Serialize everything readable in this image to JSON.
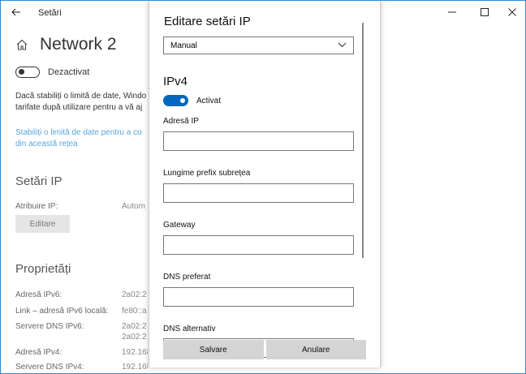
{
  "titlebar": {
    "title": "Setări",
    "icons": {
      "back": "back-arrow-icon",
      "minimize": "minimize-icon",
      "maximize": "maximize-icon",
      "close": "close-icon"
    }
  },
  "background": {
    "page_title": "Network 2",
    "home_icon": "home-icon",
    "toggle_label": "Dezactivat",
    "description_lines": [
      "Dacă stabiliți o limită de date, Windo",
      "tarifate după utilizare pentru a vă aj"
    ],
    "link_lines": [
      "Stabiliți o limită de date pentru a co",
      "din această rețea"
    ],
    "ip_section": {
      "heading": "Setări IP",
      "assign_label": "Atribuire IP:",
      "assign_value": "Autom",
      "edit_button": "Editare"
    },
    "properties": {
      "heading": "Proprietăți",
      "rows": [
        {
          "label": "Adresă IPv6:",
          "values": [
            "2a02:2"
          ]
        },
        {
          "label": "Link – adresă IPv6 locală:",
          "values": [
            "fe80::a"
          ]
        },
        {
          "label": "Servere DNS IPv6:",
          "values": [
            "2a02:2",
            "2a02:2"
          ]
        },
        {
          "label": "Adresă IPv4:",
          "values": [
            "192.168"
          ]
        },
        {
          "label": "Servere DNS IPv4:",
          "values": [
            "192.168"
          ]
        }
      ]
    }
  },
  "dialog": {
    "title": "Editare setări IP",
    "mode": {
      "value": "Manual",
      "chevron_icon": "chevron-down-icon"
    },
    "section": "IPv4",
    "toggle": {
      "label": "Activat",
      "on": true,
      "color": "#0067c0"
    },
    "fields": {
      "ip_address": {
        "label": "Adresă IP",
        "value": ""
      },
      "prefix": {
        "label": "Lungime prefix subrețea",
        "value": ""
      },
      "gateway": {
        "label": "Gateway",
        "value": ""
      },
      "dns_preferred": {
        "label": "DNS preferat",
        "value": ""
      },
      "dns_alternate": {
        "label": "DNS alternativ",
        "value": ""
      }
    },
    "save_button": "Salvare",
    "cancel_button": "Anulare"
  }
}
